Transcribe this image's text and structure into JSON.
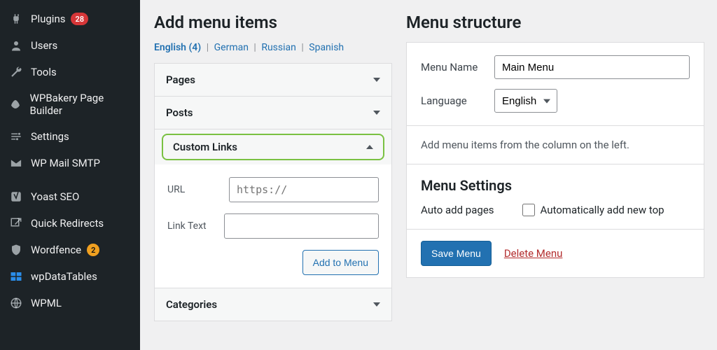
{
  "sidebar": {
    "items": [
      {
        "icon": "plug",
        "label": "Plugins",
        "badge": "28",
        "badgeColor": "red"
      },
      {
        "icon": "user",
        "label": "Users"
      },
      {
        "icon": "wrench",
        "label": "Tools"
      },
      {
        "icon": "wpbakery",
        "label": "WPBakery Page Builder"
      },
      {
        "icon": "sliders",
        "label": "Settings"
      },
      {
        "icon": "mail",
        "label": "WP Mail SMTP"
      },
      {
        "sep": true
      },
      {
        "icon": "yoast",
        "label": "Yoast SEO"
      },
      {
        "icon": "redirect",
        "label": "Quick Redirects"
      },
      {
        "icon": "shield",
        "label": "Wordfence",
        "badge": "2",
        "badgeColor": "orange"
      },
      {
        "icon": "wpdt",
        "label": "wpDataTables"
      },
      {
        "icon": "wpml",
        "label": "WPML"
      }
    ]
  },
  "left": {
    "heading": "Add menu items",
    "languages": [
      {
        "label": "English (4)",
        "current": true
      },
      {
        "label": "German"
      },
      {
        "label": "Russian"
      },
      {
        "label": "Spanish"
      }
    ],
    "acc": {
      "pages": {
        "title": "Pages"
      },
      "posts": {
        "title": "Posts"
      },
      "customLinks": {
        "title": "Custom Links",
        "url_label": "URL",
        "url_placeholder": "https://",
        "linktext_label": "Link Text",
        "addButton": "Add to Menu"
      },
      "categories": {
        "title": "Categories"
      }
    }
  },
  "right": {
    "heading": "Menu structure",
    "menuNameLabel": "Menu Name",
    "menuNameValue": "Main Menu",
    "languageLabel": "Language",
    "languageValue": "English",
    "emptyHint": "Add menu items from the column on the left.",
    "settingsHeading": "Menu Settings",
    "autoAddLabel": "Auto add pages",
    "autoAddCheckbox": "Automatically add new top",
    "saveButton": "Save Menu",
    "deleteLink": "Delete Menu"
  }
}
